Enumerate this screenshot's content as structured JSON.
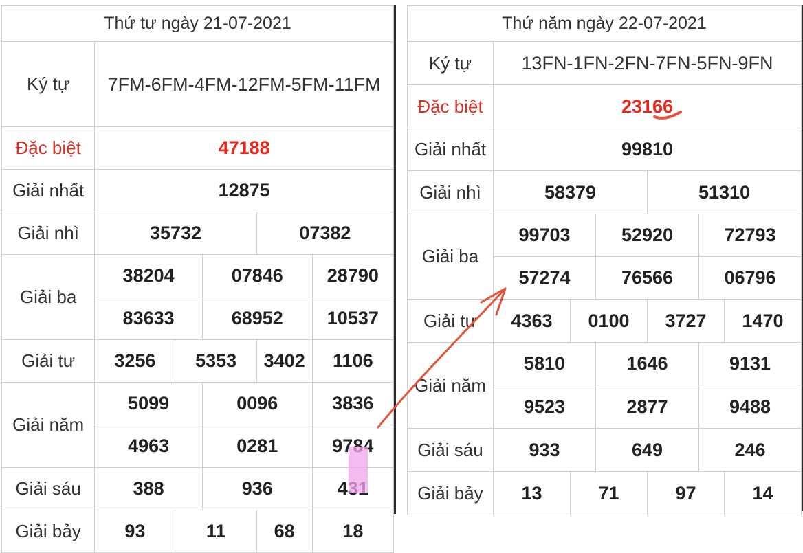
{
  "left": {
    "title": "Thứ tư ngày 21-07-2021",
    "kytu_label": "Ký tự",
    "kytu_value": "7FM-6FM-4FM-12FM-5FM-11FM",
    "special_label": "Đặc biệt",
    "special_value": "47188",
    "first_label": "Giải nhất",
    "first_value": "12875",
    "second_label": "Giải nhì",
    "second_values": [
      "35732",
      "07382"
    ],
    "third_label": "Giải ba",
    "third_values": [
      "38204",
      "07846",
      "28790",
      "83633",
      "68952",
      "10537"
    ],
    "fourth_label": "Giải tư",
    "fourth_values": [
      "3256",
      "5353",
      "3402",
      "1106"
    ],
    "fifth_label": "Giải năm",
    "fifth_values": [
      "5099",
      "0096",
      "3836",
      "4963",
      "0281",
      "9784"
    ],
    "sixth_label": "Giải sáu",
    "sixth_values": [
      "388",
      "936",
      "431"
    ],
    "seventh_label": "Giải bảy",
    "seventh_values": [
      "93",
      "11",
      "68",
      "18"
    ]
  },
  "right": {
    "title": "Thứ năm ngày 22-07-2021",
    "kytu_label": "Ký tự",
    "kytu_value": "13FN-1FN-2FN-7FN-5FN-9FN",
    "special_label": "Đặc biệt",
    "special_value": "23166",
    "first_label": "Giải nhất",
    "first_value": "99810",
    "second_label": "Giải nhì",
    "second_values": [
      "58379",
      "51310"
    ],
    "third_label": "Giải ba",
    "third_values": [
      "99703",
      "52920",
      "72793",
      "57274",
      "76566",
      "06796"
    ],
    "fourth_label": "Giải tư",
    "fourth_values": [
      "4363",
      "0100",
      "3727",
      "1470"
    ],
    "fifth_label": "Giải năm",
    "fifth_values": [
      "5810",
      "1646",
      "9131",
      "9523",
      "2877",
      "9488"
    ],
    "sixth_label": "Giải sáu",
    "sixth_values": [
      "933",
      "649",
      "246"
    ],
    "seventh_label": "Giải bảy",
    "seventh_values": [
      "13",
      "71",
      "97",
      "14"
    ]
  },
  "colors": {
    "special_text": "#e8261c",
    "annotation_arrow": "#e4533a",
    "highlight": "#f2a6ee"
  }
}
